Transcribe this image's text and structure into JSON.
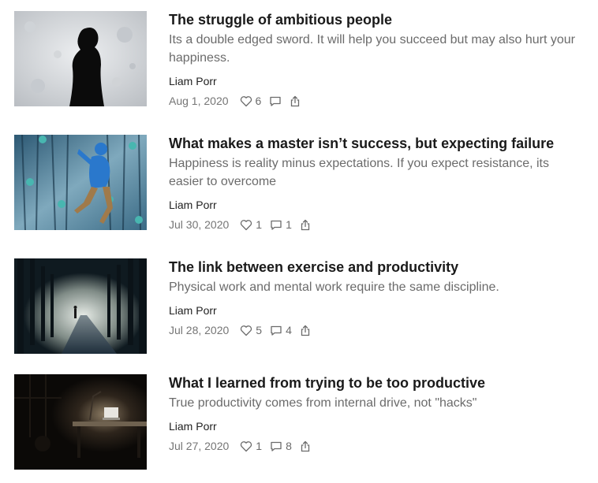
{
  "posts": [
    {
      "title": "The struggle of ambitious people",
      "subtitle": "Its a double edged sword. It will help you succeed but may also hurt your happiness.",
      "author": "Liam Porr",
      "date": "Aug 1, 2020",
      "likes": "6",
      "comments": "",
      "thumb_icon": "silhouette-on-moon-image",
      "colors": {
        "bg1": "#c9ccd0",
        "bg2": "#e9eaec",
        "fg": "#0d0d0d"
      }
    },
    {
      "title": "What makes a master isn’t success, but expecting failure",
      "subtitle": "Happiness is reality minus expectations. If you expect resistance, its easier to overcome",
      "author": "Liam Porr",
      "date": "Jul 30, 2020",
      "likes": "1",
      "comments": "1",
      "thumb_icon": "climber-on-wall-image",
      "colors": {
        "bg1": "#274d66",
        "bg2": "#8fb8cc",
        "fg": "#1f6fc4"
      }
    },
    {
      "title": "The link between exercise and productivity",
      "subtitle": "Physical work and mental work require the same discipline.",
      "author": "Liam Porr",
      "date": "Jul 28, 2020",
      "likes": "5",
      "comments": "4",
      "thumb_icon": "forest-path-runner-image",
      "colors": {
        "bg1": "#0f1a22",
        "bg2": "#c8cfc9",
        "fg": "#2a3b48"
      }
    },
    {
      "title": "What I learned from trying to be too productive",
      "subtitle": "True productivity comes from internal drive, not \"hacks\"",
      "author": "Liam Porr",
      "date": "Jul 27, 2020",
      "likes": "1",
      "comments": "8",
      "thumb_icon": "dark-desk-lamp-image",
      "colors": {
        "bg1": "#0d0b09",
        "bg2": "#3a2f25",
        "fg": "#e8e6e0"
      }
    }
  ],
  "icons": {
    "like": "heart-icon",
    "comment": "comment-icon",
    "share": "share-icon"
  }
}
